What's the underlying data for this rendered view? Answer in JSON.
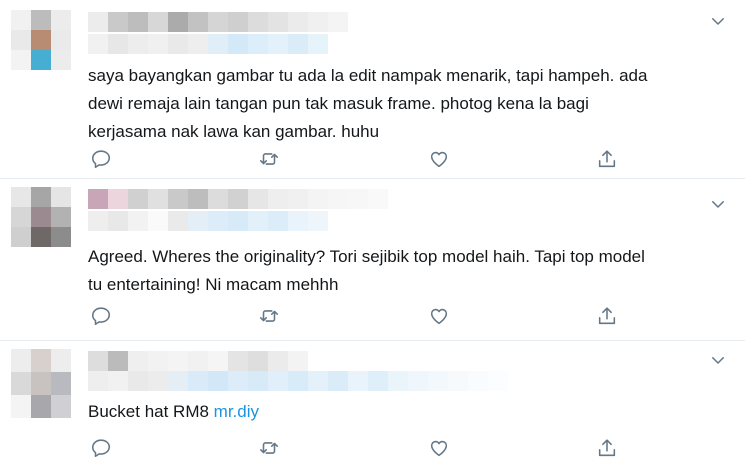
{
  "colors": {
    "text": "#14171a",
    "icon": "#657786",
    "link": "#1b95e0",
    "divider": "#e6ecf0"
  },
  "tweets": [
    {
      "text": "saya bayangkan gambar tu ada la edit nampak menarik, tapi hampeh. ada\ndewi remaja lain tangan pun tak masuk frame. photog kena la bagi\nkerjasama nak lawa kan gambar. huhu",
      "link": ""
    },
    {
      "text": "Agreed. Wheres the originality? Tori sejibik top model haih. Tapi top model\ntu entertaining! Ni macam mehhh",
      "link": ""
    },
    {
      "text": "Bucket hat RM8 ",
      "link": "mr.diy"
    }
  ],
  "icons": {
    "reply": "reply-icon",
    "retweet": "retweet-icon",
    "like": "like-icon",
    "share": "share-icon",
    "more": "chevron-down-icon"
  }
}
